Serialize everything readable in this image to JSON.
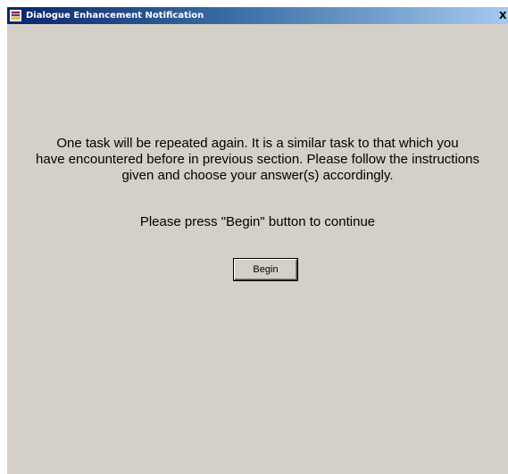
{
  "window": {
    "title": "Dialogue Enhancement Notification",
    "close_glyph": "X",
    "icon": "app-window-icon"
  },
  "content": {
    "message_lines": [
      "One task will be repeated again.  It is a similar task to that which you",
      "have encountered before in previous section. Please follow the instructions",
      "given and choose your answer(s) accordingly."
    ],
    "prompt": "Please press \"Begin\" button to continue",
    "begin_label": "Begin"
  },
  "colors": {
    "window_background": "#d4d0c8",
    "titlebar_start": "#0a246a",
    "titlebar_end": "#a6caf0"
  }
}
